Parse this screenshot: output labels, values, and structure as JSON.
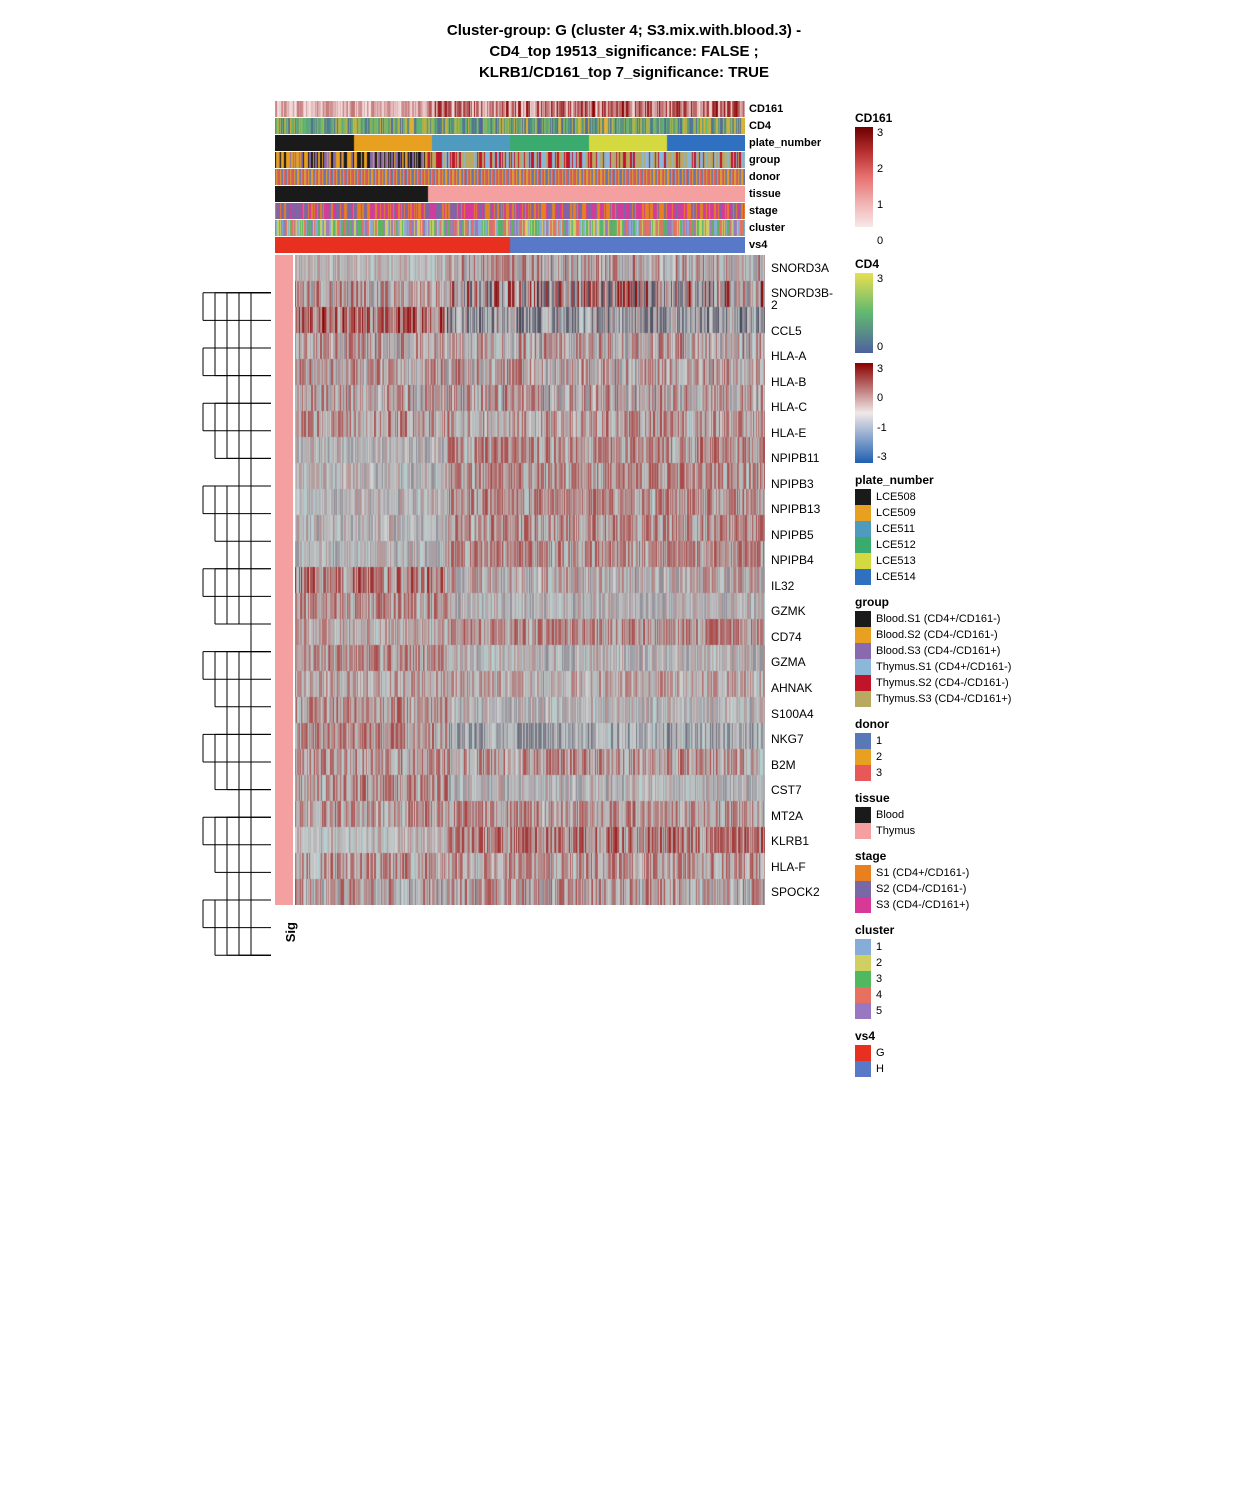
{
  "title": "Cluster-group: G (cluster 4; S3.mix.with.blood.3) -\nCD4_top 19513_significance: FALSE ;\nKLRB1/CD161_top 7_significance: TRUE",
  "annotation_labels": [
    "CD161",
    "CD4",
    "plate_number",
    "group",
    "donor",
    "tissue",
    "stage",
    "cluster",
    "vs4"
  ],
  "gene_labels": [
    "SNORD3A",
    "SNORD3B-2",
    "CCL5",
    "HLA-A",
    "HLA-B",
    "HLA-C",
    "HLA-E",
    "NPIPB11",
    "NPIPB3",
    "NPIPB13",
    "NPIPB5",
    "NPIPB4",
    "IL32",
    "GZMK",
    "CD74",
    "GZMA",
    "AHNAK",
    "S100A4",
    "NKG7",
    "B2M",
    "CST7",
    "MT2A",
    "KLRB1",
    "HLA-F",
    "SPOCK2"
  ],
  "legend": {
    "cd161_title": "CD161",
    "cd161_max": "3",
    "cd161_mid": "2",
    "cd161_mid2": "1",
    "cd161_min": "0",
    "cd4_title": "CD4",
    "cd4_max": "3",
    "cd4_min": "0",
    "scale_max": "3",
    "scale_min": "-3",
    "scale_mid": "0",
    "plate_number_title": "plate_number",
    "plate_items": [
      {
        "label": "LCE508",
        "color": "#1A1A1A"
      },
      {
        "label": "LCE509",
        "color": "#E8A020"
      },
      {
        "label": "LCE511",
        "color": "#4E9BBF"
      },
      {
        "label": "LCE512",
        "color": "#3BAA6E"
      },
      {
        "label": "LCE513",
        "color": "#D4D940"
      },
      {
        "label": "LCE514",
        "color": "#3070C0"
      }
    ],
    "group_title": "group",
    "group_items": [
      {
        "label": "Blood.S1 (CD4+/CD161-)",
        "color": "#1A1A1A"
      },
      {
        "label": "Blood.S2 (CD4-/CD161-)",
        "color": "#E8A020"
      },
      {
        "label": "Blood.S3 (CD4-/CD161+)",
        "color": "#8A6AAF"
      },
      {
        "label": "Thymus.S1 (CD4+/CD161-)",
        "color": "#8AB8D8"
      },
      {
        "label": "Thymus.S2 (CD4-/CD161-)",
        "color": "#C0142A"
      },
      {
        "label": "Thymus.S3 (CD4-/CD161+)",
        "color": "#B8A860"
      }
    ],
    "donor_title": "donor",
    "donor_items": [
      {
        "label": "1",
        "color": "#5878B8"
      },
      {
        "label": "2",
        "color": "#E8A020"
      },
      {
        "label": "3",
        "color": "#E85858"
      }
    ],
    "tissue_title": "tissue",
    "tissue_items": [
      {
        "label": "Blood",
        "color": "#1A1A1A"
      },
      {
        "label": "Thymus",
        "color": "#F4A0A0"
      }
    ],
    "stage_title": "stage",
    "stage_items": [
      {
        "label": "S1 (CD4+/CD161-)",
        "color": "#E88020"
      },
      {
        "label": "S2 (CD4-/CD161-)",
        "color": "#7868A8"
      },
      {
        "label": "S3 (CD4-/CD161+)",
        "color": "#D83898"
      }
    ],
    "cluster_title": "cluster",
    "cluster_items": [
      {
        "label": "1",
        "color": "#88ACD8"
      },
      {
        "label": "2",
        "color": "#D0D060"
      },
      {
        "label": "3",
        "color": "#50B860"
      },
      {
        "label": "4",
        "color": "#E87060"
      },
      {
        "label": "5",
        "color": "#9878C0"
      }
    ],
    "vs4_title": "vs4",
    "vs4_items": [
      {
        "label": "G",
        "color": "#E83020"
      },
      {
        "label": "H",
        "color": "#5878C8"
      }
    ]
  },
  "sig_label": "Sig"
}
